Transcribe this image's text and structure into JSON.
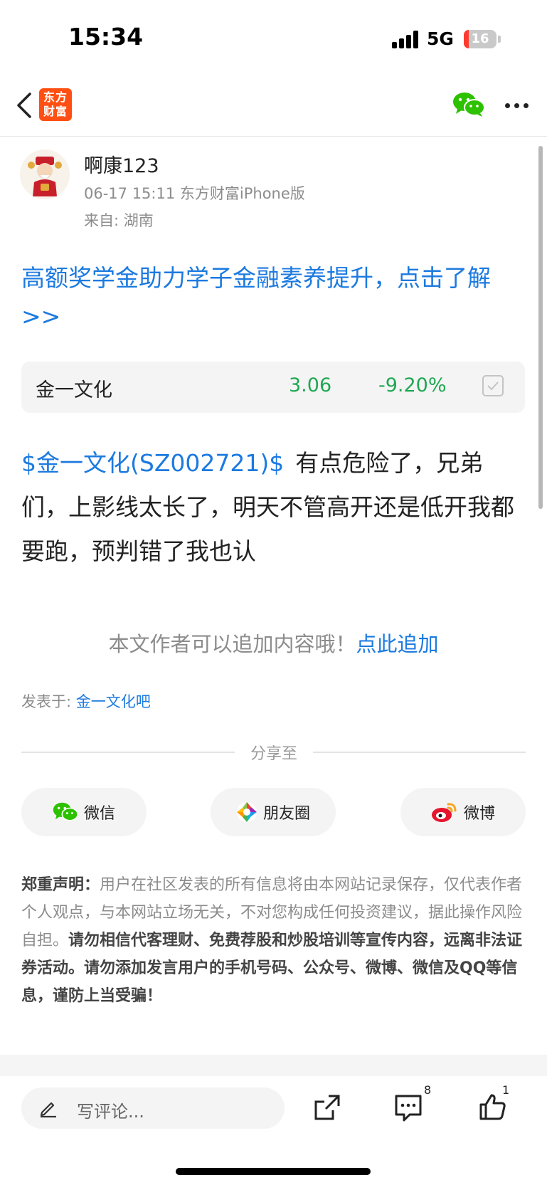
{
  "status_bar": {
    "time": "15:34",
    "network": "5G",
    "battery": "16",
    "battery_level_percent": 16
  },
  "nav": {
    "logo_line1": "东方",
    "logo_line2": "财富"
  },
  "post": {
    "author": "啊康123",
    "meta": "06-17 15:11 东方财富iPhone版",
    "location": "来自: 湖南",
    "promo": "高额奖学金助力学子金融素养提升，点击了解>>",
    "stock": {
      "name": "金一文化",
      "price": "3.06",
      "change": "-9.20%"
    },
    "stock_tag": "$金一文化(SZ002721)$",
    "body": "有点危险了，兄弟们，上影线太长了，明天不管高开还是低开我都要跑，预判错了我也认",
    "append_prompt": "本文作者可以追加内容哦！",
    "append_link": "点此追加",
    "posted_in_label": "发表于: ",
    "posted_in_bar": "金一文化吧"
  },
  "share": {
    "label": "分享至",
    "buttons": [
      {
        "label": "微信"
      },
      {
        "label": "朋友圈"
      },
      {
        "label": "微博"
      }
    ]
  },
  "disclaimer": {
    "title": "郑重声明：",
    "text": "用户在社区发表的所有信息将由本网站记录保存，仅代表作者个人观点，与本网站立场无关，不对您构成任何投资建议，据此操作风险自担。",
    "bold": "请勿相信代客理财、免费荐股和炒股培训等宣传内容，远离非法证券活动。请勿添加发言用户的手机号码、公众号、微博、微信及QQ等信息，谨防上当受骗！"
  },
  "bottom_bar": {
    "comment_placeholder": "写评论...",
    "comment_count": "8",
    "like_count": "1"
  },
  "colors": {
    "brand": "#ff4f12",
    "link": "#1c7ae0",
    "down": "#1ea852",
    "wechat": "#2dc100"
  }
}
